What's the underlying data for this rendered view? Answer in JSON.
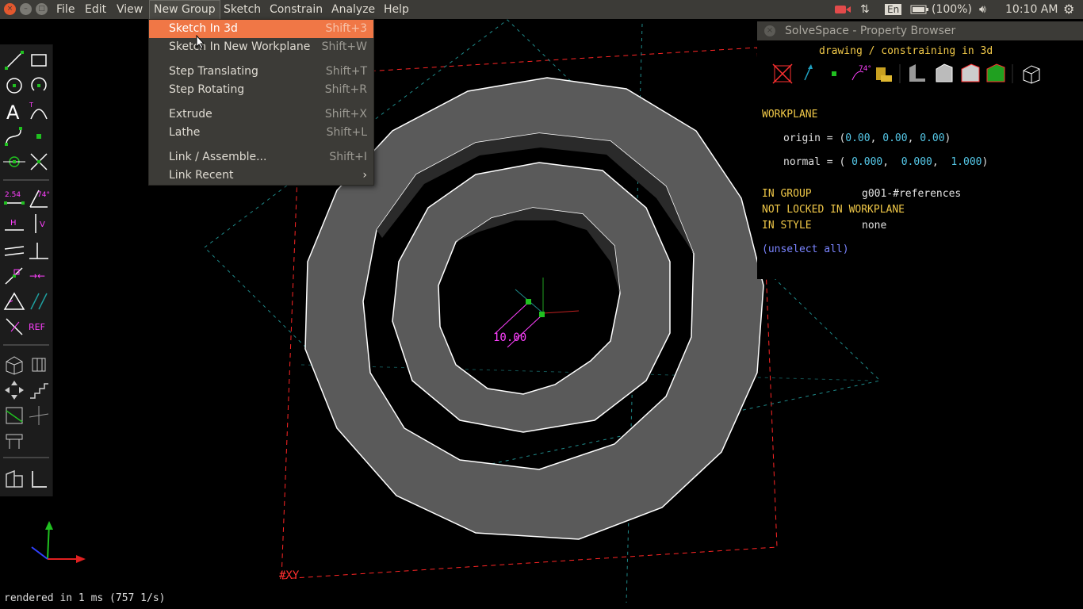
{
  "menubar": {
    "items": [
      "File",
      "Edit",
      "View",
      "New Group",
      "Sketch",
      "Constrain",
      "Analyze",
      "Help"
    ],
    "active": "New Group"
  },
  "tray": {
    "keyboard": "En",
    "battery": "(100%)",
    "clock": "10:10 AM"
  },
  "dropdown": {
    "items": [
      {
        "label": "Sketch In 3d",
        "shortcut": "Shift+3"
      },
      {
        "label": "Sketch In New Workplane",
        "shortcut": "Shift+W"
      },
      {
        "label": "Step Translating",
        "shortcut": "Shift+T"
      },
      {
        "label": "Step Rotating",
        "shortcut": "Shift+R"
      },
      {
        "label": "Extrude",
        "shortcut": "Shift+X"
      },
      {
        "label": "Lathe",
        "shortcut": "Shift+L"
      },
      {
        "label": "Link / Assemble...",
        "shortcut": "Shift+I"
      },
      {
        "label": "Link Recent",
        "shortcut": "›"
      }
    ]
  },
  "toolbar": {
    "dim_label": "2.54",
    "angle_label": "74°",
    "h_label": "H",
    "v_label": "V",
    "ref_label": "REF"
  },
  "property_browser": {
    "title": "SolveSpace - Property Browser",
    "mode": "drawing / constraining in 3d",
    "angle_icon_label": "74°",
    "heading": "WORKPLANE",
    "origin_label": "origin = (",
    "origin_values": [
      "0.00",
      "0.00",
      "0.00"
    ],
    "normal_label": "normal = (",
    "normal_values": [
      "0.000",
      "0.000",
      "1.000"
    ],
    "in_group_label": "IN GROUP",
    "in_group_value": "g001-#references",
    "not_locked": "NOT LOCKED IN WORKPLANE",
    "in_style_label": "IN STYLE",
    "in_style_value": "none",
    "unselect": "(unselect all)"
  },
  "canvas": {
    "dimension_label": "10.00",
    "plane_label": "#XY"
  },
  "status": "rendered in 1 ms (757 1/s)",
  "colors": {
    "menu_bg": "#3c3b37",
    "highlight": "#f07746",
    "constraint": "#ff40ff",
    "workplane": "#ff2020",
    "point": "#20c020"
  }
}
